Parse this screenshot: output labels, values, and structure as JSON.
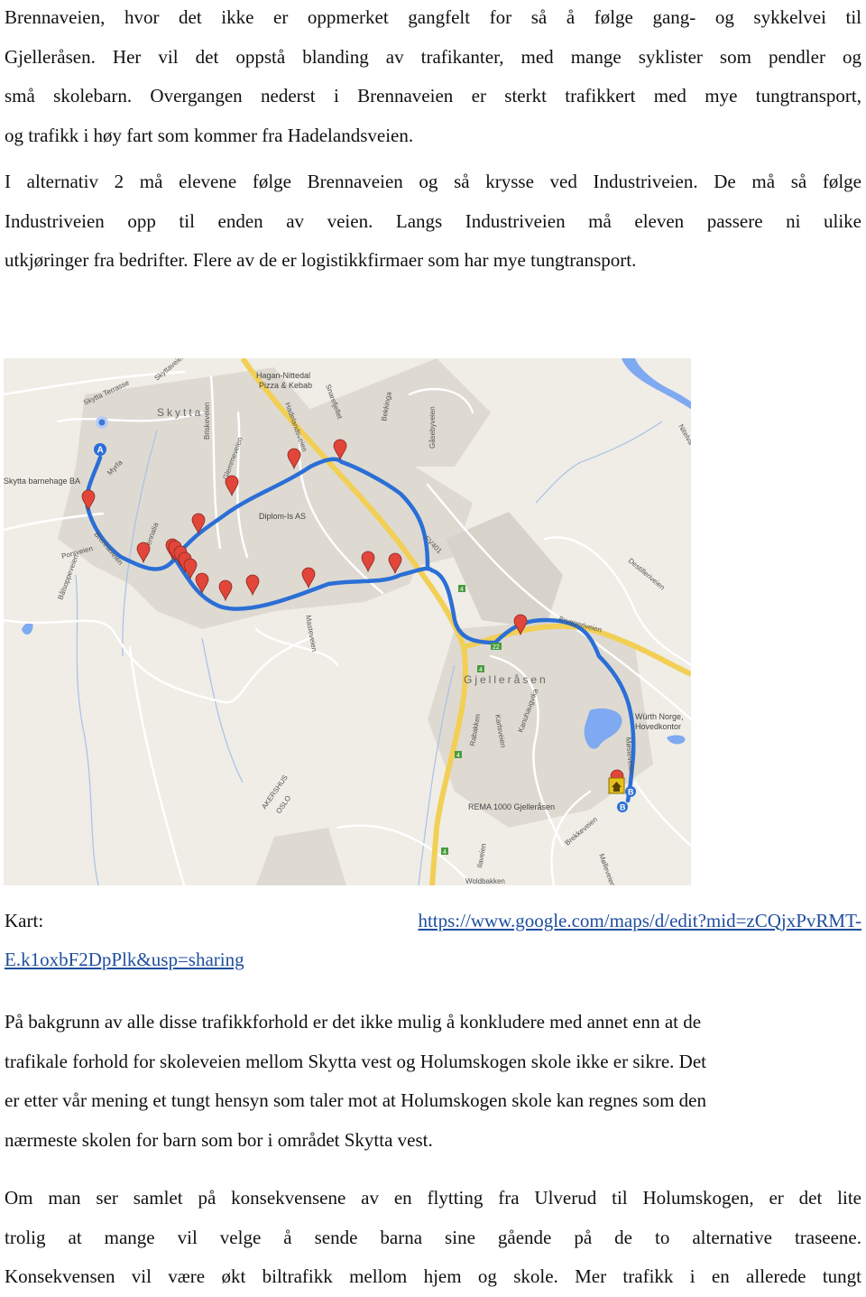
{
  "paragraph1": {
    "lines": [
      "Brennaveien, hvor det ikke er oppmerket gangfelt for så å følge gang- og sykkelvei til",
      "Gjelleråsen. Her vil det oppstå blanding av trafikanter, med mange syklister som pendler og",
      "små skolebarn. Overgangen nederst i Brennaveien er sterkt trafikkert med mye tungtransport,",
      "og trafikk i høy fart som kommer fra Hadelandsveien."
    ]
  },
  "paragraph2": {
    "lines": [
      "I alternativ 2 må elevene følge Brennaveien og så krysse ved Industriveien. De må så følge",
      "Industriveien opp til enden av veien. Langs Industriveien må eleven passere ni ulike",
      "utkjøringer fra bedrifter. Flere av de er logistikkfirmaer som har mye tungtransport."
    ]
  },
  "map": {
    "place_labels": [
      "Skytta",
      "Gjelleråsen"
    ],
    "poi_labels": [
      "Hagan-Nittedal",
      "Pizza & Kebab",
      "Skytta barnehage BA",
      "Diplom-Is AS",
      "Würth Norge,",
      "Hovedkontor",
      "REMA 1000 Gjelleråsen"
    ],
    "street_labels": [
      "Skytta Terrasse",
      "Skyttaveien",
      "Myrfa",
      "Porsveien",
      "Brennaveien",
      "Brennalia",
      "Briskeveien",
      "Glemmeveien",
      "Hadelandsveien",
      "Snarefjellet",
      "Bekkinga",
      "Gåsebyveien",
      "FV401",
      "Bryggeriveien",
      "Destilleriveien",
      "Karlsveien",
      "Kanuhaugvika",
      "Rabakken",
      "Møsteveien",
      "Ilaveien",
      "Woldbakken",
      "Brekkeveien",
      "Bålsoppeveien",
      "Masteveien",
      "Nitelva",
      "AKERSHUS",
      "OSLO",
      "Mølleveien"
    ],
    "road_shields": [
      "4",
      "22",
      "4",
      "4",
      "4"
    ],
    "marker_start": "A",
    "marker_end": "B",
    "colors": {
      "route": "#2b6fd6",
      "pin": "#e2453a",
      "water": "#7fa9f0",
      "major_road": "#f2cf55",
      "land": "#efede6",
      "urban": "#dedad2"
    }
  },
  "kart": {
    "label": "Kart:",
    "link_line1": "https://www.google.com/maps/d/edit?mid=zCQjxPvRMT-",
    "link_line2": "E.k1oxbF2DpPlk&usp=sharing"
  },
  "paragraph3": {
    "lines": [
      "På bakgrunn av alle disse trafikkforhold er det ikke mulig å konkludere med annet enn at de",
      "trafikale forhold for skoleveien mellom Skytta vest og Holumskogen skole ikke er sikre. Det",
      "er etter vår mening et tungt hensyn som taler mot at Holumskogen skole kan regnes som den",
      "nærmeste skolen for barn som bor i området Skytta vest."
    ]
  },
  "paragraph4": {
    "lines": [
      "Om man ser samlet på konsekvensene av en flytting fra Ulverud til Holumskogen, er det lite",
      "trolig at mange vil velge å sende barna sine gående på de to alternative traseene.",
      "Konsekvensen vil være økt biltrafikk mellom hjem og skole. Mer trafikk i en allerede tungt"
    ]
  }
}
